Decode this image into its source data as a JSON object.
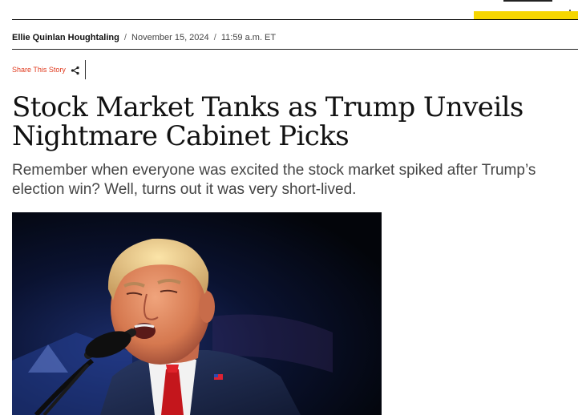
{
  "byline": {
    "author": "Ellie Quinlan Houghtaling",
    "separator": "/",
    "date": "November 15, 2024",
    "time": "11:59 a.m. ET"
  },
  "share": {
    "label": "Share This Story",
    "icon": "share-icon",
    "accent_color": "#e03a1e"
  },
  "article": {
    "headline": "Stock Market Tanks as Trump Unveils Nightmare Cabinet Picks",
    "dek": "Remember when everyone was excited the stock market spiked after Trump’s election win? Well, turns out it was very short-lived."
  },
  "header": {
    "accent_color": "#f6d600"
  }
}
